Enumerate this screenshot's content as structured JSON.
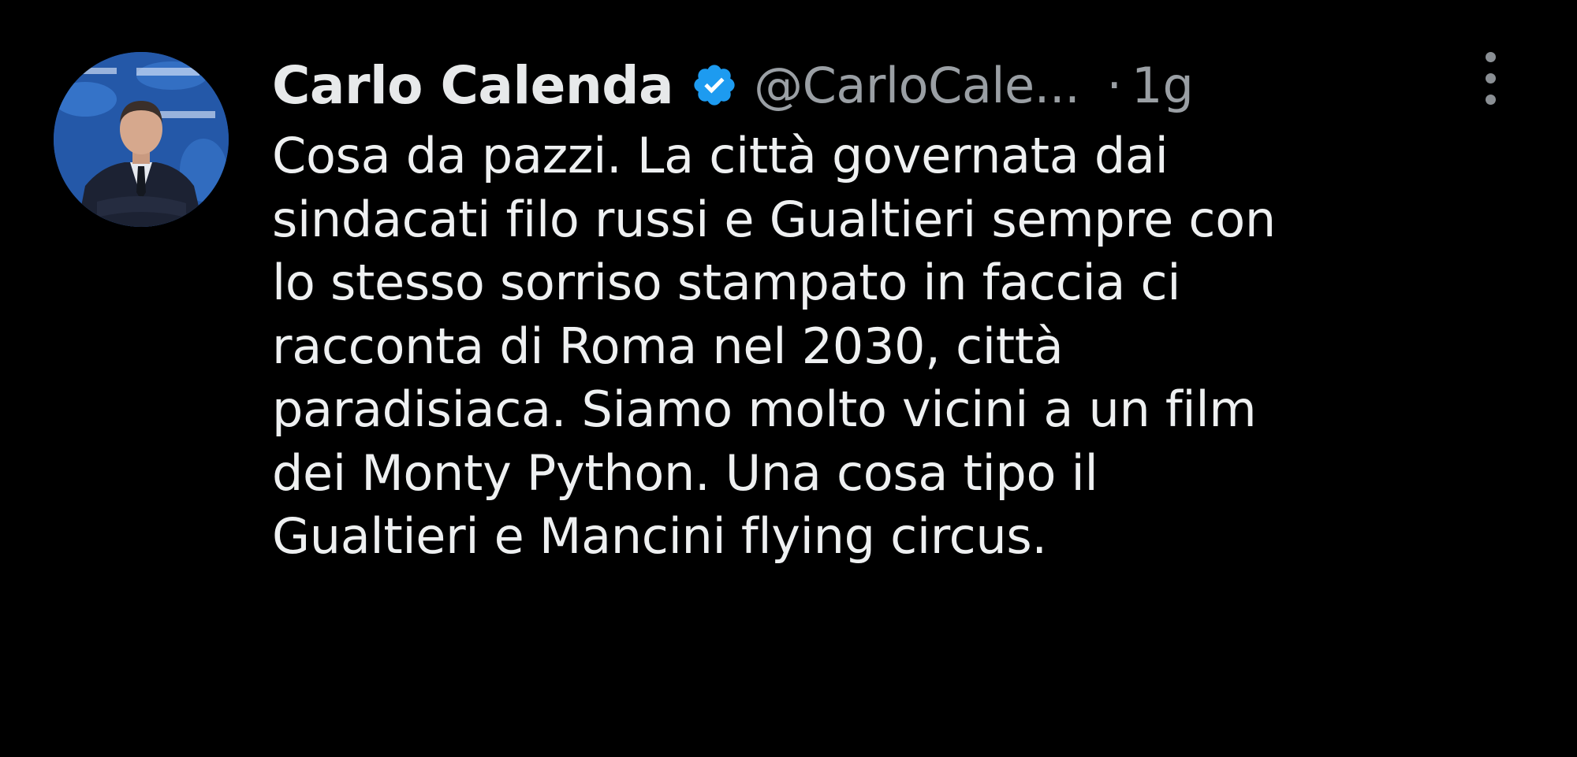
{
  "tweet": {
    "author": {
      "name": "Carlo Calenda",
      "handle": "@CarloCale...",
      "verified": true,
      "verified_color": "#1d9bf0",
      "avatar_icon": "profile-photo"
    },
    "separator": "·",
    "time": "1g",
    "more_icon": "more-vertical-icon",
    "text_lines": [
      "Cosa da pazzi. La città governata dai",
      "sindacati filo russi e Gualtieri sempre con",
      "lo stesso sorriso stampato in faccia ci",
      "racconta di Roma nel 2030, città",
      "paradisiaca. Siamo molto vicini a un film",
      "dei Monty Python. Una cosa tipo il",
      "Gualtieri e Mancini flying circus."
    ]
  },
  "colors": {
    "background": "#000000",
    "text": "#e7e9ea",
    "secondary_text": "#9a9fa4",
    "accent": "#1d9bf0"
  }
}
